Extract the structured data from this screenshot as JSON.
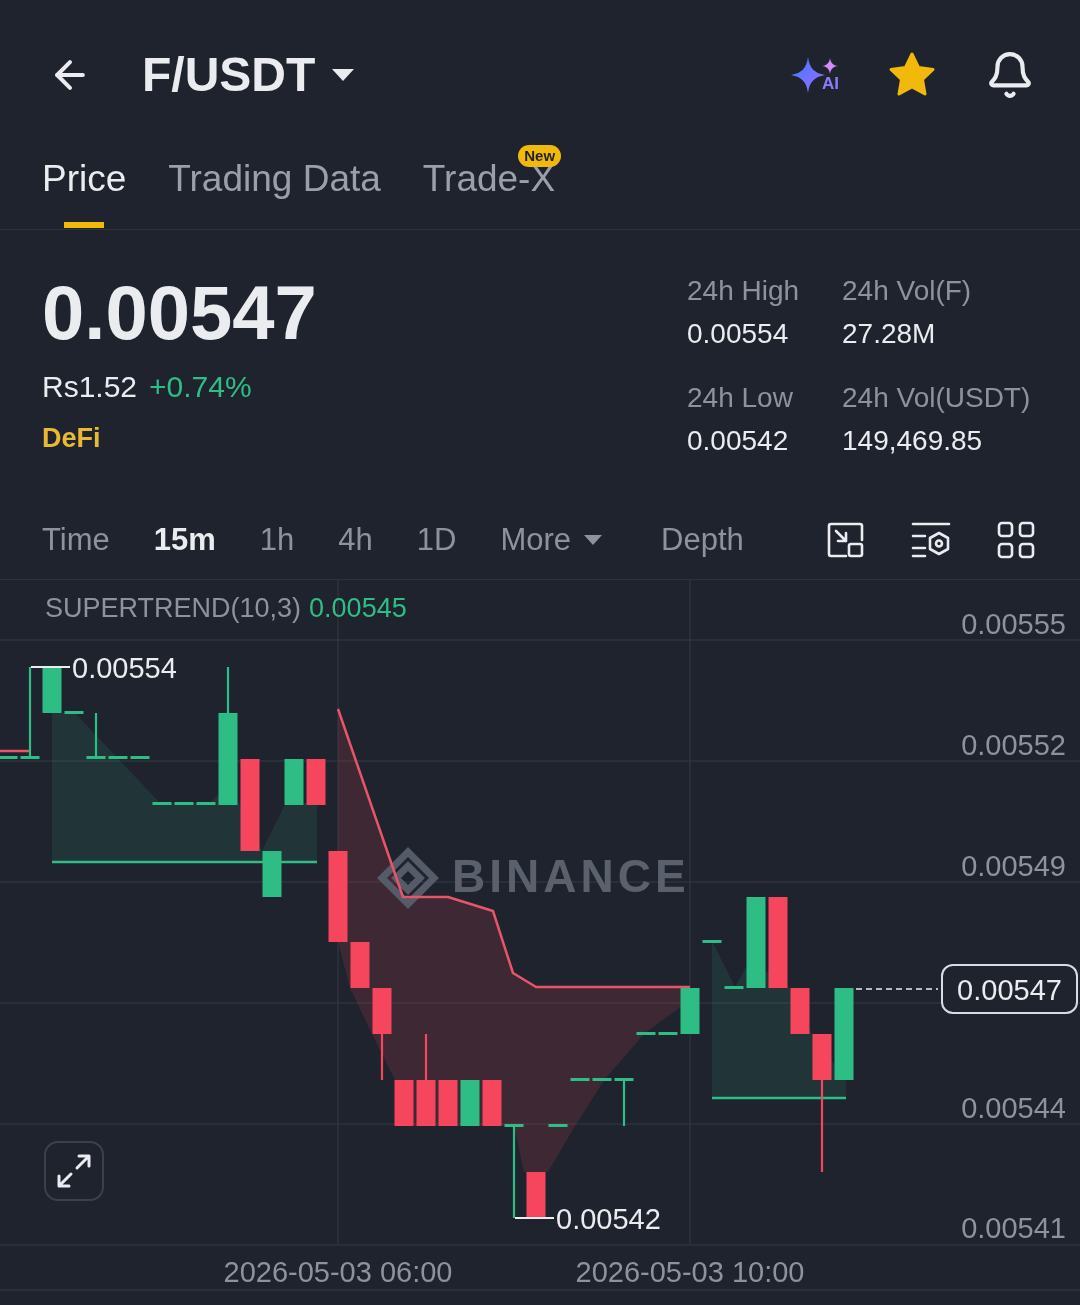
{
  "header": {
    "title": "F/USDT",
    "ai_label": "AI",
    "favorited": true
  },
  "tabs": [
    {
      "label": "Price",
      "selected": true
    },
    {
      "label": "Trading Data",
      "selected": false
    },
    {
      "label": "Trade-X",
      "selected": false,
      "badge": "New"
    }
  ],
  "ticker": {
    "price": "0.00547",
    "fiat_price": "Rs1.52",
    "change": "+0.74%",
    "tag": "DeFi"
  },
  "stats": [
    {
      "label": "24h High",
      "value": "0.00554"
    },
    {
      "label": "24h Vol(F)",
      "value": "27.28M"
    },
    {
      "label": "24h Low",
      "value": "0.00542"
    },
    {
      "label": "24h Vol(USDT)",
      "value": "149,469.85"
    }
  ],
  "intervals": [
    {
      "label": "Time",
      "selected": false,
      "kind": "option"
    },
    {
      "label": "15m",
      "selected": true,
      "kind": "option"
    },
    {
      "label": "1h",
      "selected": false,
      "kind": "option"
    },
    {
      "label": "4h",
      "selected": false,
      "kind": "option"
    },
    {
      "label": "1D",
      "selected": false,
      "kind": "option"
    },
    {
      "label": "More",
      "selected": false,
      "kind": "menu"
    }
  ],
  "depth_tab": {
    "label": "Depth",
    "selected": false
  },
  "chart": {
    "indicator": {
      "name": "SUPERTREND(10,3)",
      "value": "0.00545"
    },
    "price_axis": [
      "0.00555",
      "0.00552",
      "0.00549",
      "0.00544",
      "0.00541"
    ],
    "current_price": "0.00547",
    "high_marker": "0.00554",
    "low_marker": "0.00542",
    "time_axis": [
      "2026-05-03 06:00",
      "2026-05-03 10:00"
    ],
    "watermark": "BINANCE"
  }
}
